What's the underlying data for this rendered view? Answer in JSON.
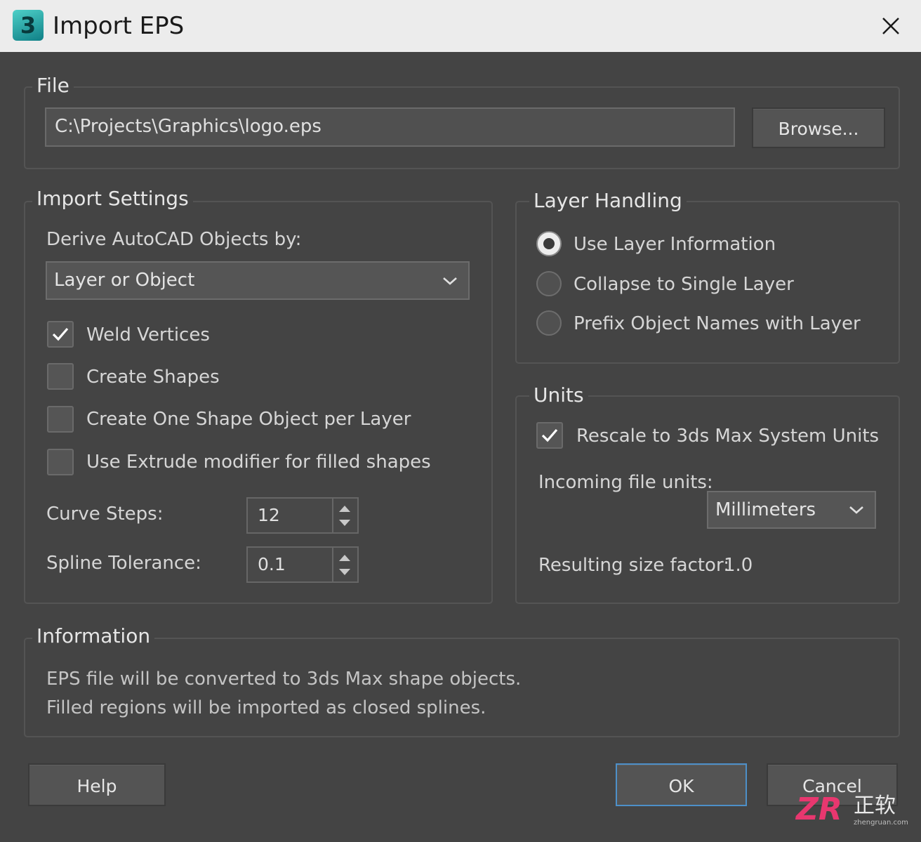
{
  "window": {
    "title": "Import EPS",
    "app_icon": "3ds-max-icon",
    "app_icon_label": "3",
    "close_icon": "close-icon"
  },
  "file": {
    "group_label": "File",
    "path_value": "C:\\Projects\\Graphics\\logo.eps",
    "browse_label": "Browse..."
  },
  "import_settings": {
    "group_label": "Import Settings",
    "derive_label": "Derive AutoCAD Objects by:",
    "derive_selected": "Layer or Object",
    "checkboxes": [
      {
        "label": "Weld Vertices",
        "checked": true
      },
      {
        "label": "Create Shapes",
        "checked": false
      },
      {
        "label": "Create One Shape Object per Layer",
        "checked": false
      },
      {
        "label": "Use Extrude modifier for filled shapes",
        "checked": false
      }
    ],
    "curve_steps_label": "Curve Steps:",
    "curve_steps_value": "12",
    "spline_tolerance_label": "Spline Tolerance:",
    "spline_tolerance_value": "0.1"
  },
  "layer_handling": {
    "group_label": "Layer Handling",
    "options": [
      {
        "label": "Use Layer Information",
        "selected": true
      },
      {
        "label": "Collapse to Single Layer",
        "selected": false
      },
      {
        "label": "Prefix Object Names with Layer",
        "selected": false
      }
    ]
  },
  "units": {
    "group_label": "Units",
    "rescale_label": "Rescale to 3ds Max System Units",
    "rescale_checked": true,
    "incoming_label": "Incoming file units:",
    "incoming_selected": "Millimeters",
    "size_factor_label": "Resulting size factor:",
    "size_factor_value": "1.0"
  },
  "information": {
    "group_label": "Information",
    "line1": "EPS file will be converted to 3ds Max shape objects.",
    "line2": "Filled regions will be imported as closed splines."
  },
  "buttons": {
    "help": "Help",
    "ok": "OK",
    "cancel": "Cancel"
  },
  "watermark": {
    "letters": "ZR",
    "cn": "正软",
    "url": "zhengruan.com"
  },
  "colors": {
    "background": "#444444",
    "titlebar": "#ececec",
    "primary_border": "#4d90c9",
    "watermark_accent": "#e8376f"
  }
}
